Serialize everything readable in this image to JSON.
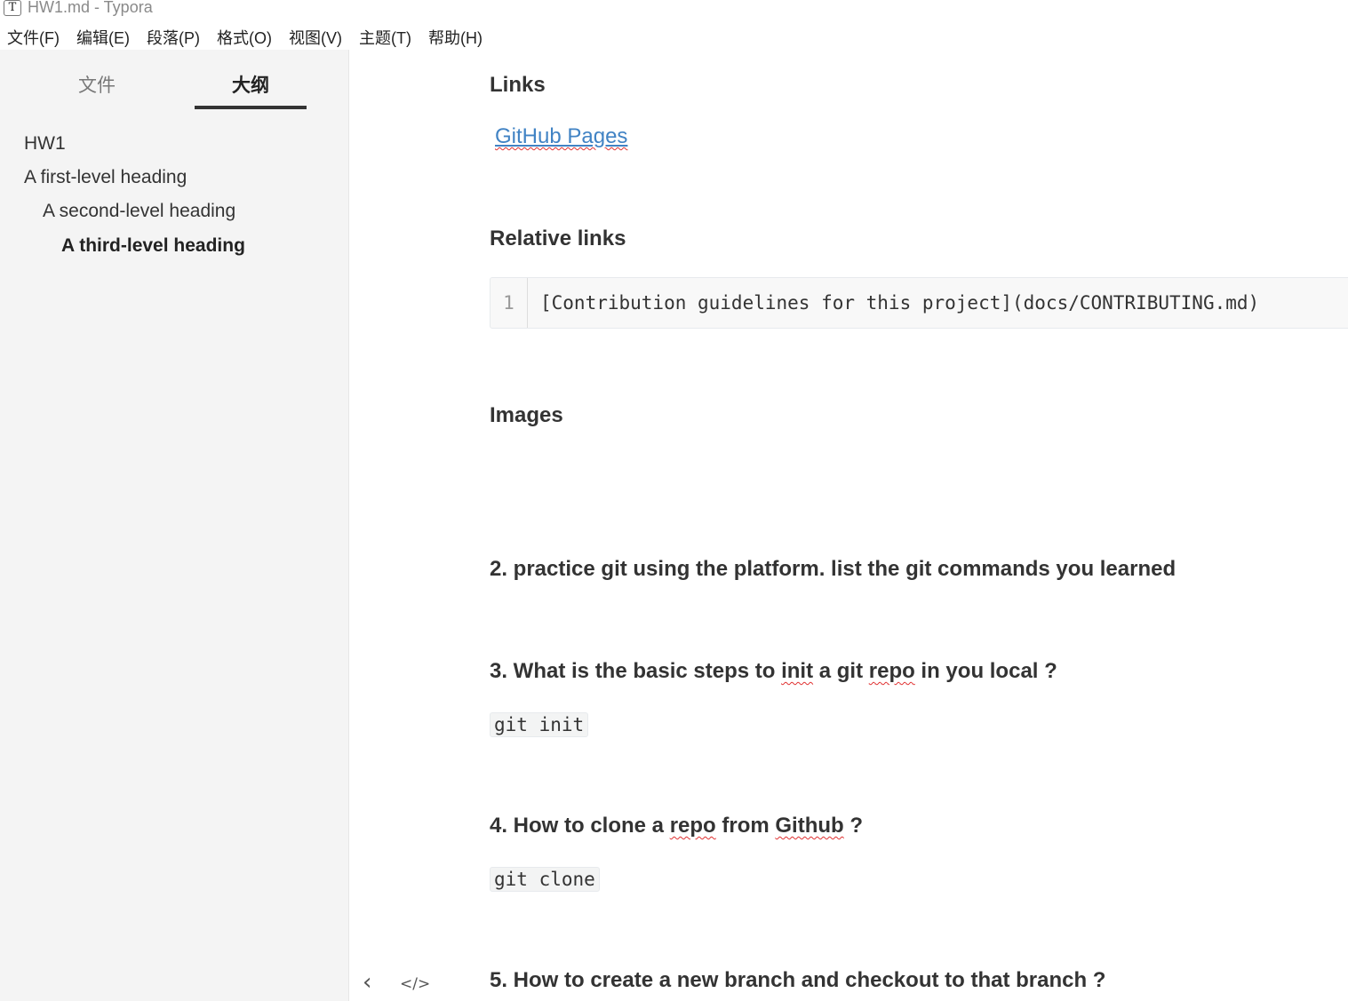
{
  "window": {
    "title": "HW1.md - Typora",
    "app_icon": "T"
  },
  "menubar": [
    "文件(F)",
    "编辑(E)",
    "段落(P)",
    "格式(O)",
    "视图(V)",
    "主题(T)",
    "帮助(H)"
  ],
  "sidebar": {
    "tabs": [
      "文件",
      "大纲"
    ],
    "active_tab": "大纲",
    "outline": [
      {
        "label": "HW1",
        "level": 1,
        "active": false
      },
      {
        "label": "A first-level heading",
        "level": 1,
        "active": false
      },
      {
        "label": "A second-level heading",
        "level": 2,
        "active": false
      },
      {
        "label": "A third-level heading",
        "level": 3,
        "active": true
      }
    ]
  },
  "editor": {
    "links_heading": "Links",
    "link_text": "GitHub Pages",
    "relative_links_heading": "Relative links",
    "code_block": {
      "line_number": "1",
      "code": "[Contribution guidelines for this project](docs/CONTRIBUTING.md)"
    },
    "images_heading": "Images",
    "q2": "2. practice git using the platform. list the git commands you learned",
    "q3": {
      "before": "3. What is the basic steps to ",
      "w1": "init",
      "mid1": " a git ",
      "w2": "repo",
      "after": " in you local ?"
    },
    "q3_code": "git init",
    "q4": {
      "before": "4. How to clone a ",
      "w1": "repo",
      "mid1": " from ",
      "w2": "Github",
      "after": " ?"
    },
    "q4_code": "git clone",
    "q5": "5. How to create a new branch and checkout to that branch ?"
  },
  "footer": {
    "toggle_sidebar": "‹",
    "source_mode": "</>"
  },
  "colors": {
    "sidebar_bg": "#f4f4f4",
    "link": "#4183c4",
    "text": "#333333",
    "code_bg": "#f8f8f8"
  }
}
